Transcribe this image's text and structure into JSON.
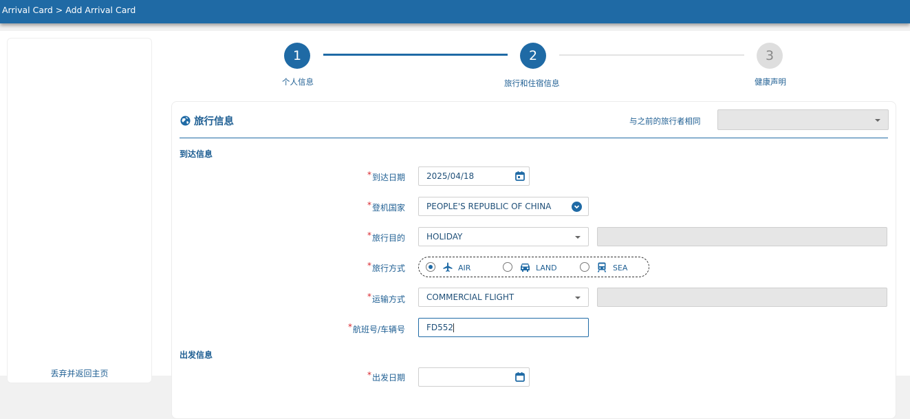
{
  "header": {
    "breadcrumb": "Arrival Card > Add Arrival Card"
  },
  "sidebar": {
    "discard_link": "丢弃并返回主页"
  },
  "stepper": {
    "steps": [
      {
        "number": "1",
        "label": "个人信息",
        "state": "complete"
      },
      {
        "number": "2",
        "label": "旅行和住宿信息",
        "state": "active"
      },
      {
        "number": "3",
        "label": "健康声明",
        "state": "inactive"
      }
    ]
  },
  "travel_info": {
    "title": "旅行信息",
    "same_as_label": "与之前的旅行者相同",
    "same_as_value": "",
    "arrival_section": "到达信息",
    "departure_section": "出发信息",
    "fields": {
      "arrival_date": {
        "label": "到达日期",
        "value": "2025/04/18"
      },
      "embark_country": {
        "label": "登机国家",
        "value": "PEOPLE'S REPUBLIC OF CHINA"
      },
      "purpose": {
        "label": "旅行目的",
        "value": "HOLIDAY",
        "other_value": ""
      },
      "travel_mode": {
        "label": "旅行方式",
        "options": [
          "AIR",
          "LAND",
          "SEA"
        ],
        "selected": "AIR"
      },
      "transport": {
        "label": "运输方式",
        "value": "COMMERCIAL FLIGHT",
        "other_value": ""
      },
      "flight_no": {
        "label": "航班号/车辆号",
        "value": "FD552"
      },
      "departure_date": {
        "label": "出发日期"
      }
    }
  },
  "colors": {
    "primary": "#1f6aa5",
    "required": "#d9282f",
    "disabled": "#e6e6e6"
  },
  "icons": [
    "globe-icon",
    "calendar-icon",
    "chevron-down-circle-icon",
    "caret-down-icon",
    "plane-icon",
    "car-icon",
    "train-icon"
  ]
}
